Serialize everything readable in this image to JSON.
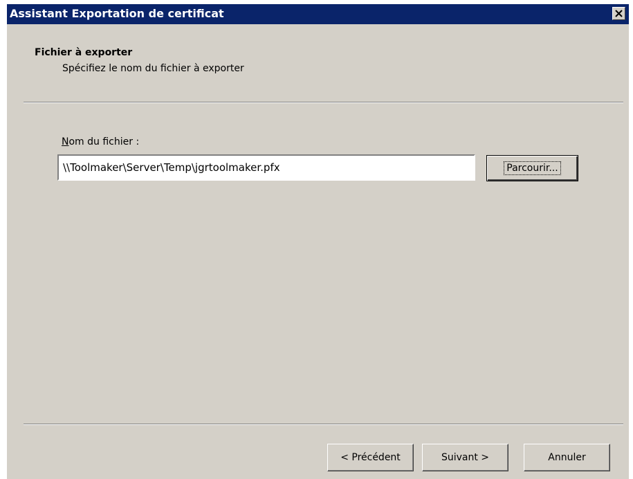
{
  "window": {
    "title": "Assistant Exportation de certificat",
    "close_glyph": "×"
  },
  "header": {
    "title": "Fichier à exporter",
    "subtitle": "Spécifiez le nom du fichier à exporter"
  },
  "form": {
    "filename_label_accel": "N",
    "filename_label_rest": "om du fichier :",
    "filename_value": "\\\\Toolmaker\\Server\\Temp\\jgrtoolmaker.pfx",
    "browse_label": "Parcourir..."
  },
  "footer": {
    "prev_label": "< Précédent",
    "next_label": "Suivant >",
    "cancel_label": "Annuler"
  },
  "colors": {
    "titlebar": "#0a246a",
    "dialog_face": "#d4d0c8"
  }
}
